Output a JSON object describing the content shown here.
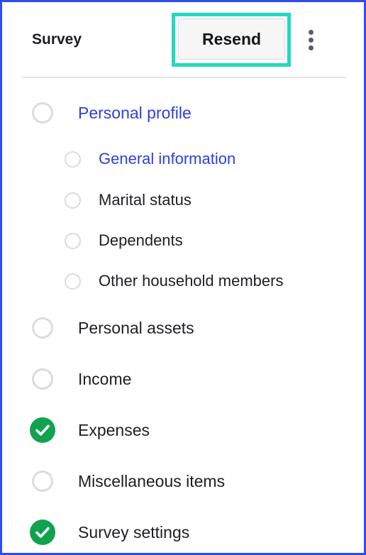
{
  "header": {
    "title": "Survey",
    "resend_label": "Resend",
    "more_icon": "vertical-ellipsis-icon"
  },
  "colors": {
    "frame_border": "#2f4dee",
    "highlight": "#25d9bf",
    "active_link": "#2f3fe0",
    "complete_green": "#11a24f",
    "pending_circle": "#dcdcde"
  },
  "steps": [
    {
      "label": "Personal profile",
      "level": 1,
      "state": "pending",
      "active": true
    },
    {
      "label": "General information",
      "level": 2,
      "state": "pending",
      "active": true
    },
    {
      "label": "Marital status",
      "level": 2,
      "state": "pending",
      "active": false
    },
    {
      "label": "Dependents",
      "level": 2,
      "state": "pending",
      "active": false
    },
    {
      "label": "Other household members",
      "level": 2,
      "state": "pending",
      "active": false
    },
    {
      "label": "Personal assets",
      "level": 1,
      "state": "pending",
      "active": false
    },
    {
      "label": "Income",
      "level": 1,
      "state": "pending",
      "active": false
    },
    {
      "label": "Expenses",
      "level": 1,
      "state": "complete",
      "active": false
    },
    {
      "label": "Miscellaneous items",
      "level": 1,
      "state": "pending",
      "active": false
    },
    {
      "label": "Survey settings",
      "level": 1,
      "state": "complete",
      "active": false
    }
  ]
}
